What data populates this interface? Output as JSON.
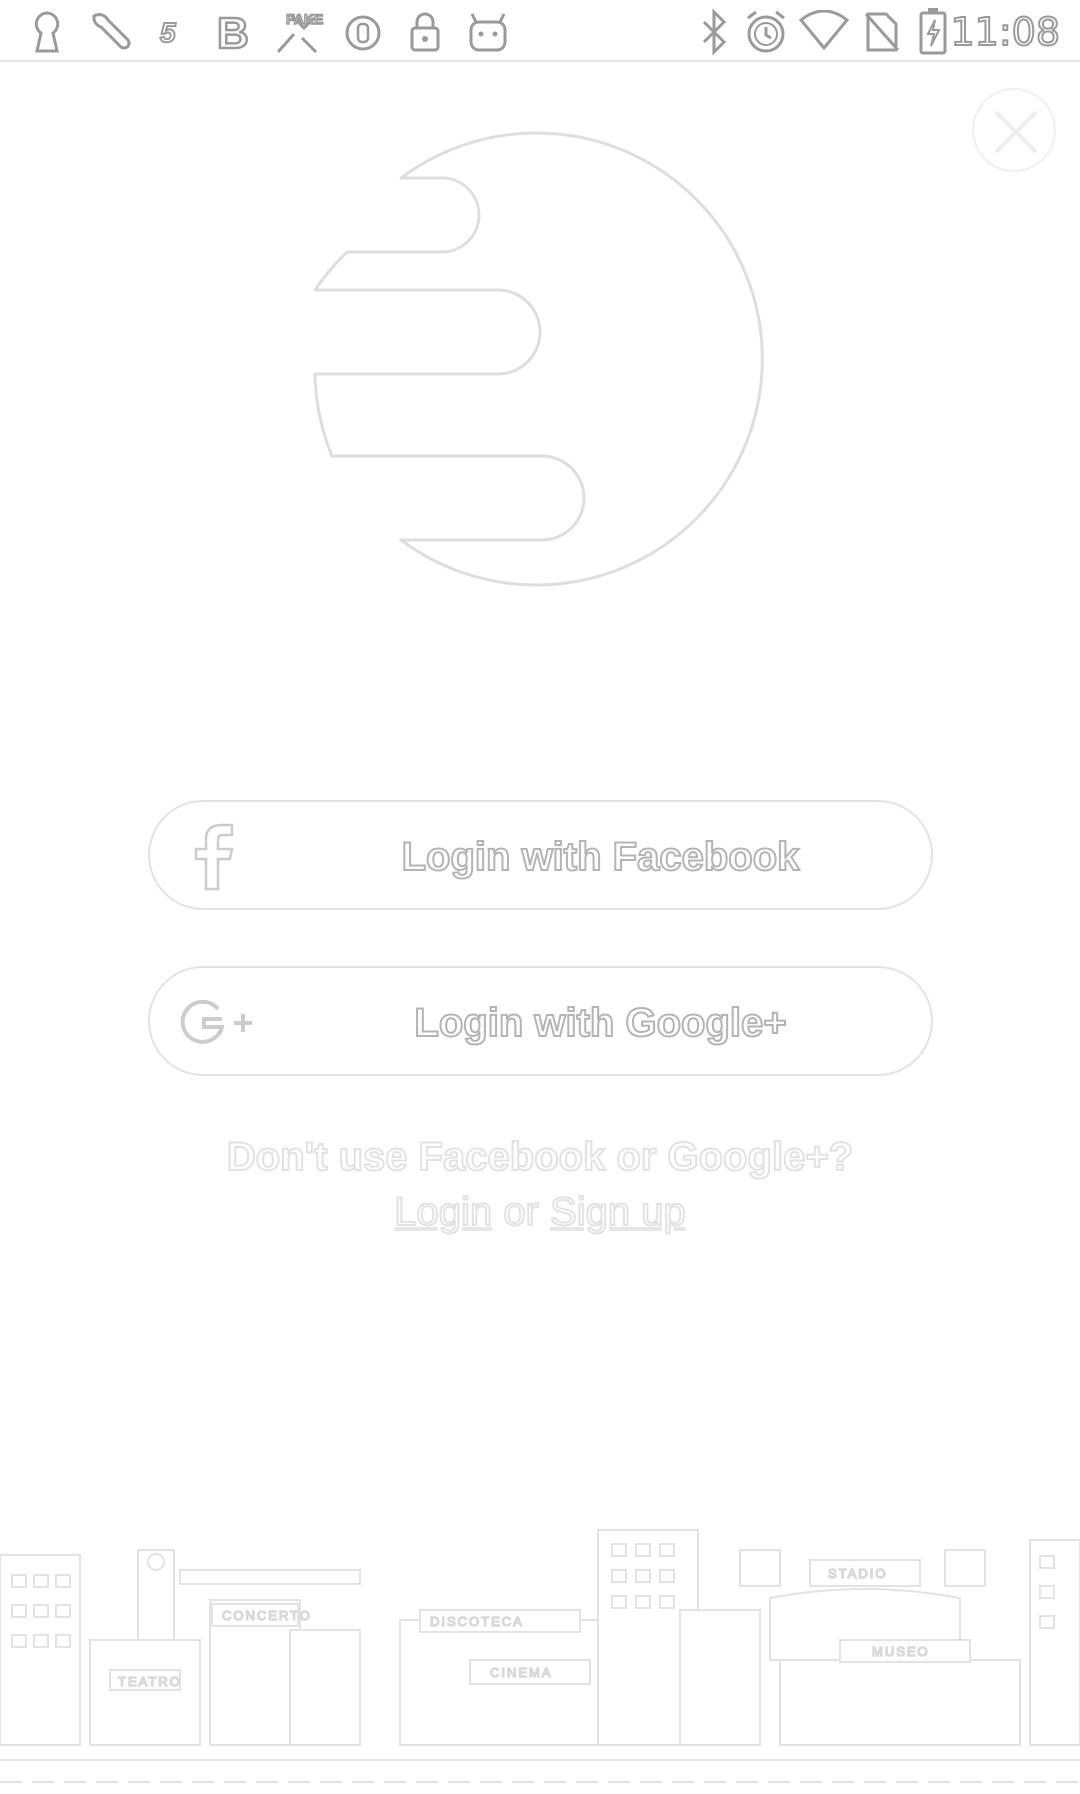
{
  "status_bar": {
    "time": "11:08",
    "left_icons": [
      "keyhole-icon",
      "wrench-icon",
      "five-icon",
      "b-icon",
      "fake-gps-icon",
      "circle-icon",
      "lock-icon",
      "android-icon"
    ],
    "right_icons": [
      "bluetooth-icon",
      "alarm-icon",
      "wifi-icon",
      "no-sim-icon",
      "battery-charging-icon"
    ]
  },
  "close_button": {
    "icon": "close-icon"
  },
  "logo": {
    "icon": "app-logo"
  },
  "login": {
    "facebook": {
      "label": "Login with Facebook",
      "icon": "facebook-icon"
    },
    "google": {
      "label": "Login with Google+",
      "icon": "google-plus-icon"
    }
  },
  "alternate": {
    "prompt": "Don't use Facebook or Google+?",
    "login_link": "Login",
    "separator": "or",
    "signup_link": "Sign up"
  },
  "city": {
    "signs": [
      "TEATRO",
      "CONCERTO",
      "DISCOTECA",
      "CINEMA",
      "STADIO",
      "MUSEO"
    ]
  },
  "colors": {
    "background": "#ffffff",
    "outline": "#e0e0e0"
  }
}
